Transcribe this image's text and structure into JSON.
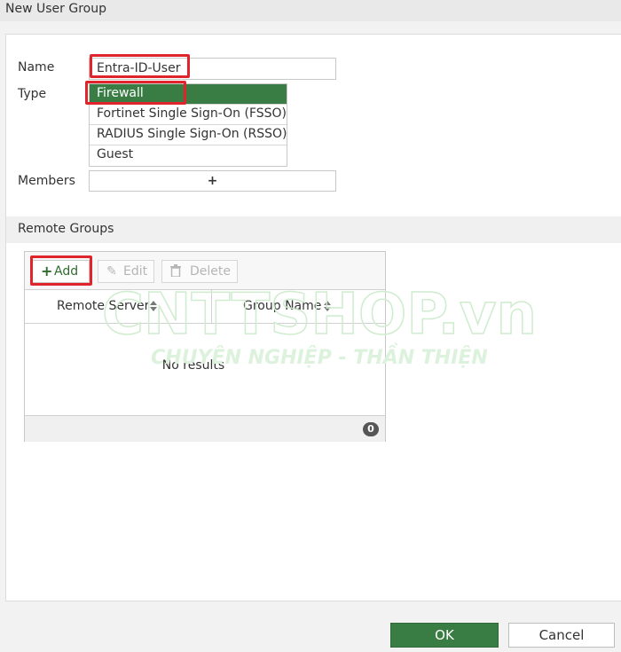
{
  "window": {
    "title": "New User Group"
  },
  "form": {
    "name_label": "Name",
    "name_value": "Entra-ID-User",
    "type_label": "Type",
    "type_options": [
      "Firewall",
      "Fortinet Single Sign-On (FSSO)",
      "RADIUS Single Sign-On (RSSO)",
      "Guest"
    ],
    "type_selected": "Firewall",
    "members_label": "Members",
    "members_add_glyph": "+"
  },
  "remote_groups": {
    "section_title": "Remote Groups",
    "toolbar": {
      "add_label": "Add",
      "edit_label": "Edit",
      "delete_label": "Delete"
    },
    "columns": [
      "Remote Server",
      "Group Name"
    ],
    "empty_text": "No results",
    "count": "0"
  },
  "watermark": {
    "line1": "CNTTSHOP.vn",
    "line2": "CHUYÊN NGHIỆP - THẦN THIỆN"
  },
  "buttons": {
    "ok_label": "OK",
    "cancel_label": "Cancel"
  },
  "colors": {
    "accent_green": "#3a7d44",
    "highlight_red": "#e0242b"
  },
  "icons": [
    "plus-icon",
    "pencil-icon",
    "trash-icon",
    "sort-icon"
  ]
}
